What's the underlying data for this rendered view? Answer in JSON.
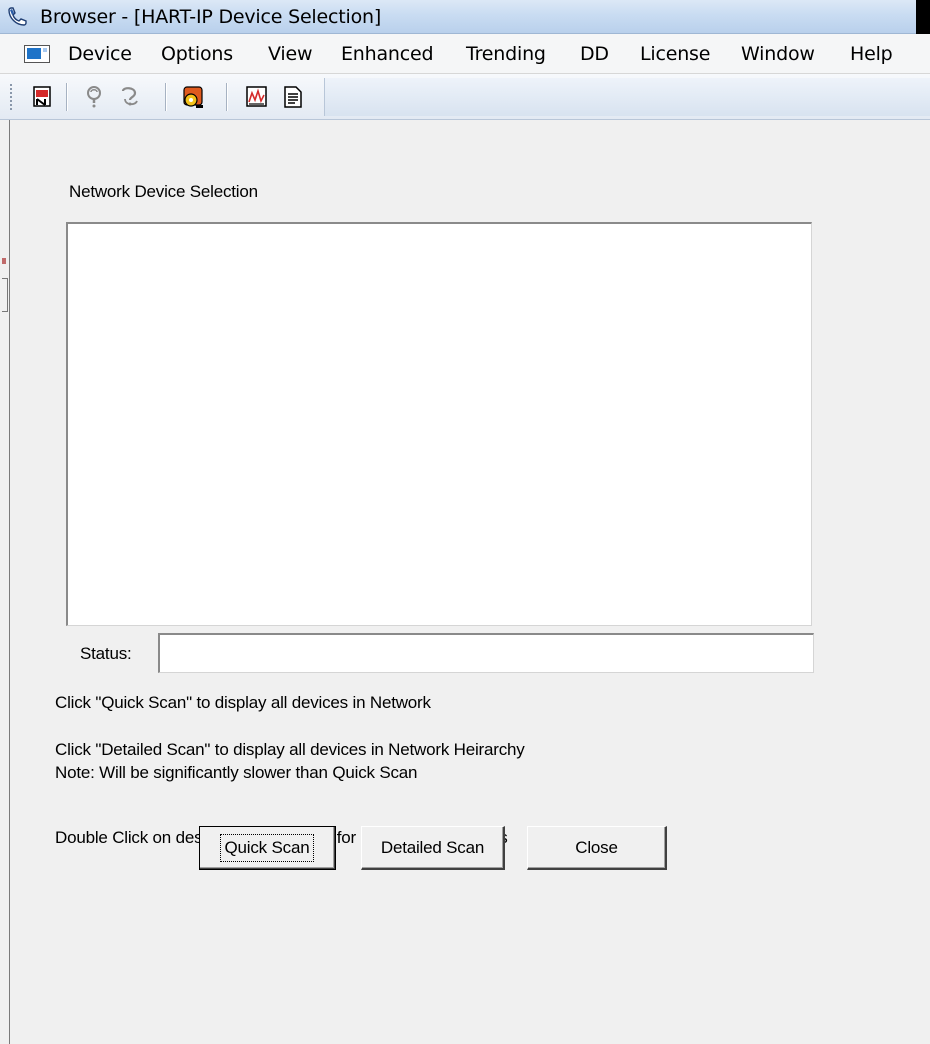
{
  "window": {
    "title": "Browser - [HART-IP Device Selection]",
    "app_icon": "phone-handset-icon"
  },
  "menubar": {
    "items": [
      "Device",
      "Options",
      "View",
      "Enhanced",
      "Trending",
      "DD",
      "License",
      "Window",
      "Help"
    ]
  },
  "toolbar": {
    "buttons": [
      "network-device-icon",
      "help-question-icon",
      "help-context-icon",
      "device-status-icon",
      "chart-icon",
      "report-document-icon"
    ]
  },
  "dialog": {
    "section_label": "Network Device Selection",
    "status_label": "Status:",
    "status_value": "",
    "instructions": {
      "quick": "Click \"Quick Scan\" to display all devices in Network",
      "detailed": "Click \"Detailed Scan\" to display all devices in Network Heirarchy",
      "note": "Note: Will be significantly slower than Quick Scan",
      "double_click": "Double Click on desired device above for configuration details"
    },
    "buttons": {
      "quick_scan": "Quick Scan",
      "detailed_scan": "Detailed Scan",
      "close": "Close"
    }
  }
}
